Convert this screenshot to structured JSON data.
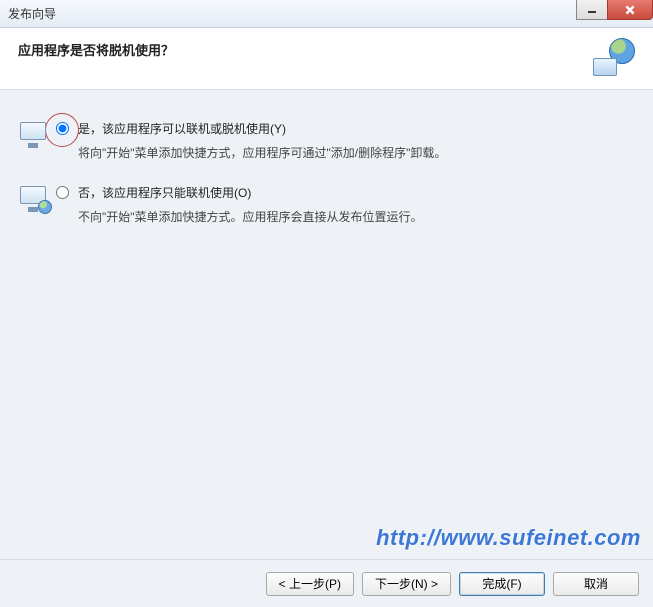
{
  "titlebar": {
    "title": "发布向导"
  },
  "header": {
    "title": "应用程序是否将脱机使用？"
  },
  "options": {
    "yes": {
      "label": "是，该应用程序可以联机或脱机使用(Y)",
      "desc": "将向\"开始\"菜单添加快捷方式，应用程序可通过\"添加/删除程序\"卸载。"
    },
    "no": {
      "label": "否，该应用程序只能联机使用(O)",
      "desc": "不向\"开始\"菜单添加快捷方式。应用程序会直接从发布位置运行。"
    }
  },
  "footer": {
    "back": "< 上一步(P)",
    "next": "下一步(N) >",
    "finish": "完成(F)",
    "cancel": "取消"
  },
  "watermark": "http://www.sufeinet.com"
}
